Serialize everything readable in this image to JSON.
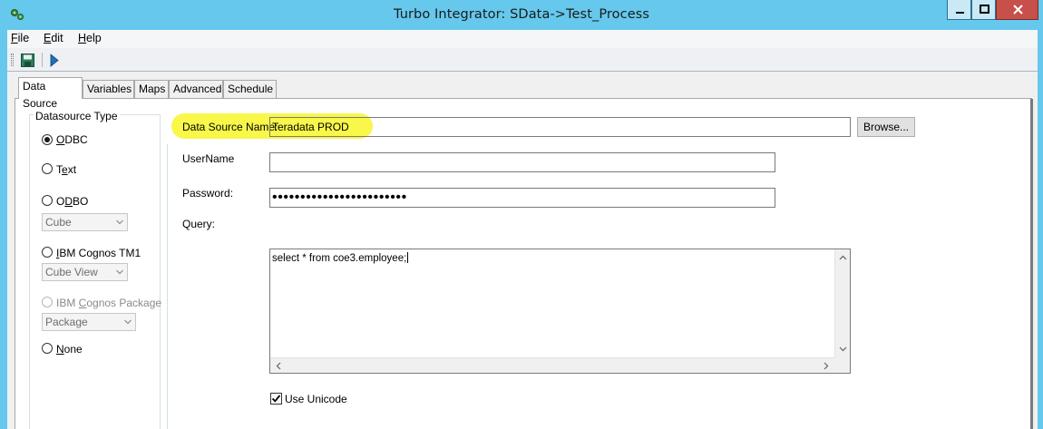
{
  "window": {
    "title": "Turbo Integrator:  SData->Test_Process",
    "icon": "gears-icon",
    "controls": [
      "minimize-icon",
      "maximize-icon",
      "close-icon"
    ]
  },
  "menu": {
    "file": {
      "accel": "F",
      "rest": "ile"
    },
    "edit": {
      "accel": "E",
      "rest": "dit"
    },
    "help": {
      "accel": "H",
      "rest": "elp"
    }
  },
  "toolbar": {
    "icons": [
      "save-icon",
      "run-icon"
    ]
  },
  "tabs": [
    "Data Source",
    "Variables",
    "Maps",
    "Advanced",
    "Schedule"
  ],
  "datasource": {
    "group_label": "Datasource Type",
    "odbc": {
      "accel": "O",
      "rest": "DBC",
      "checked": true
    },
    "text": {
      "pre": "T",
      "accel": "e",
      "rest": "xt"
    },
    "odbo": {
      "pre": "O",
      "accel": "D",
      "rest": "BO"
    },
    "odbo_combo": "Cube",
    "tm1": {
      "accel": "I",
      "rest": "BM Cognos TM1"
    },
    "tm1_combo": "Cube View",
    "package": {
      "pre": "IBM ",
      "accel": "C",
      "rest": "ognos Package"
    },
    "package_combo": "Package",
    "none": {
      "accel": "N",
      "rest": "one"
    }
  },
  "form": {
    "dsn_label": "Data Source Name:",
    "dsn_value": "Teradata PROD",
    "browse_label": "Browse...",
    "username_label": "UserName",
    "username_value": "",
    "password_label": "Password:",
    "password_value": "••••••••••••••••••••••••",
    "query_label": "Query:",
    "query_value": "select * from coe3.employee;",
    "use_unicode_label": "Use Unicode",
    "use_unicode_checked": true
  },
  "colors": {
    "titlebar": "#65c8ec",
    "highlight": "#f9f74a",
    "close_button": "#c7504a"
  }
}
